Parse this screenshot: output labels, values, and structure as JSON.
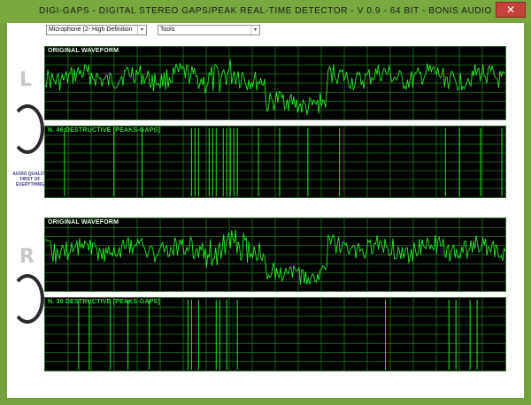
{
  "window": {
    "title": "DIGI-GAPS  -  DIGITAL  STEREO  GAPS/PEAK  REAL-TIME  DETECTOR  -  V 0.9  -  64  BIT  -  BONIS  AUDIO",
    "close_glyph": "✕"
  },
  "toolbar": {
    "input_device": "Microphone (2- High Definition",
    "tools": "Tools",
    "dropdown_glyph": "▾"
  },
  "logo": {
    "tagline": "AUDIO QUALITY FIRST OF EVERYTHING"
  },
  "channels": [
    {
      "letter": "L",
      "waveform_label": "ORIGINAL WAVEFORM",
      "destructive_label": "N. 46  DESTRUCTIVE [PEAKS-GAPS]"
    },
    {
      "letter": "R",
      "waveform_label": "ORIGINAL WAVEFORM",
      "destructive_label": "N. 39  DESTRUCTIVE [PEAKS-GAPS]"
    }
  ],
  "colors": {
    "window_frame": "#78a83e",
    "scope_bg": "#000000",
    "grid": "#1f7a1f",
    "trace": "#22ee22"
  }
}
